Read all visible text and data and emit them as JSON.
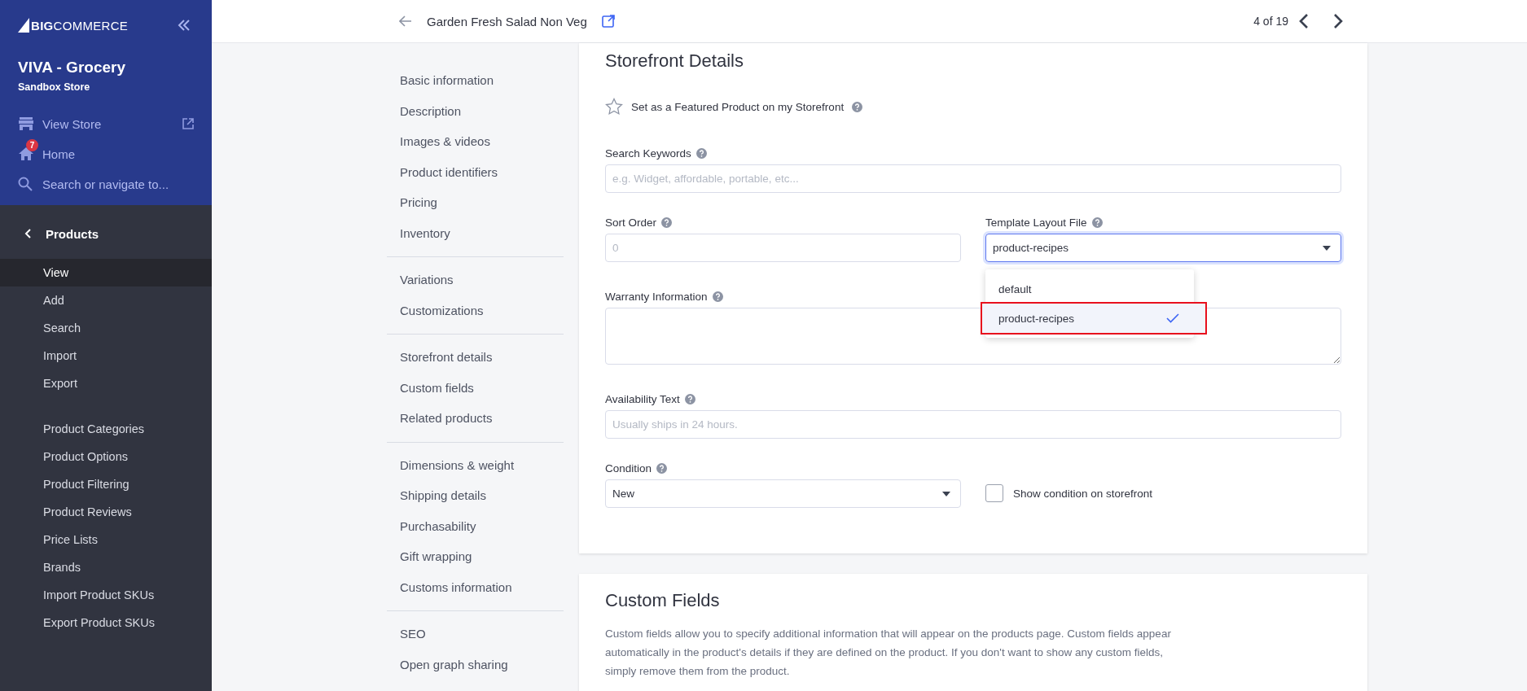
{
  "sidebar": {
    "logo": {
      "mark": "BIG",
      "word": "COMMERCE"
    },
    "store_name": "VIVA - Grocery",
    "store_type": "Sandbox Store",
    "links": [
      {
        "kind": "store",
        "label": "View Store"
      },
      {
        "kind": "home",
        "label": "Home",
        "badge": "7"
      },
      {
        "kind": "search",
        "label": "Search or navigate to..."
      }
    ],
    "section": "Products",
    "groups": [
      [
        {
          "label": "View",
          "selected": true
        },
        {
          "label": "Add",
          "selected": false
        },
        {
          "label": "Search",
          "selected": false
        },
        {
          "label": "Import",
          "selected": false
        },
        {
          "label": "Export",
          "selected": false
        }
      ],
      [
        {
          "label": "Product Categories",
          "selected": false
        },
        {
          "label": "Product Options",
          "selected": false
        },
        {
          "label": "Product Filtering",
          "selected": false
        },
        {
          "label": "Product Reviews",
          "selected": false
        },
        {
          "label": "Price Lists",
          "selected": false
        },
        {
          "label": "Brands",
          "selected": false
        },
        {
          "label": "Import Product SKUs",
          "selected": false
        },
        {
          "label": "Export Product SKUs",
          "selected": false
        }
      ]
    ]
  },
  "header": {
    "title": "Garden Fresh Salad Non Veg",
    "counter": "4 of 19"
  },
  "section_nav": [
    [
      "Basic information",
      "Description",
      "Images & videos",
      "Product identifiers",
      "Pricing",
      "Inventory"
    ],
    [
      "Variations",
      "Customizations"
    ],
    [
      "Storefront details",
      "Custom fields",
      "Related products"
    ],
    [
      "Dimensions & weight",
      "Shipping details",
      "Purchasability",
      "Gift wrapping",
      "Customs information"
    ],
    [
      "SEO",
      "Open graph sharing"
    ]
  ],
  "storefront": {
    "title": "Storefront Details",
    "featured": {
      "label": "Set as a Featured Product on my Storefront",
      "checked": false
    },
    "search_keywords": {
      "label": "Search Keywords",
      "placeholder": "e.g. Widget, affordable, portable, etc..."
    },
    "sort_order": {
      "label": "Sort Order",
      "placeholder": "0"
    },
    "template_layout": {
      "label": "Template Layout File",
      "value": "product-recipes",
      "expanded": true,
      "options": [
        {
          "label": "default",
          "selected": false,
          "highlighted": false
        },
        {
          "label": "product-recipes",
          "selected": true,
          "highlighted": true
        }
      ]
    },
    "warranty": {
      "label": "Warranty Information"
    },
    "availability": {
      "label": "Availability Text",
      "placeholder": "Usually ships in 24 hours."
    },
    "condition": {
      "label": "Condition",
      "value": "New"
    },
    "show_condition": {
      "label": "Show condition on storefront",
      "checked": false
    }
  },
  "custom_fields": {
    "title": "Custom Fields",
    "description": "Custom fields allow you to specify additional information that will appear on the products page. Custom fields appear automatically in the product's details if they are defined on the product. If you don't want to show any custom fields, simply remove them from the product."
  }
}
